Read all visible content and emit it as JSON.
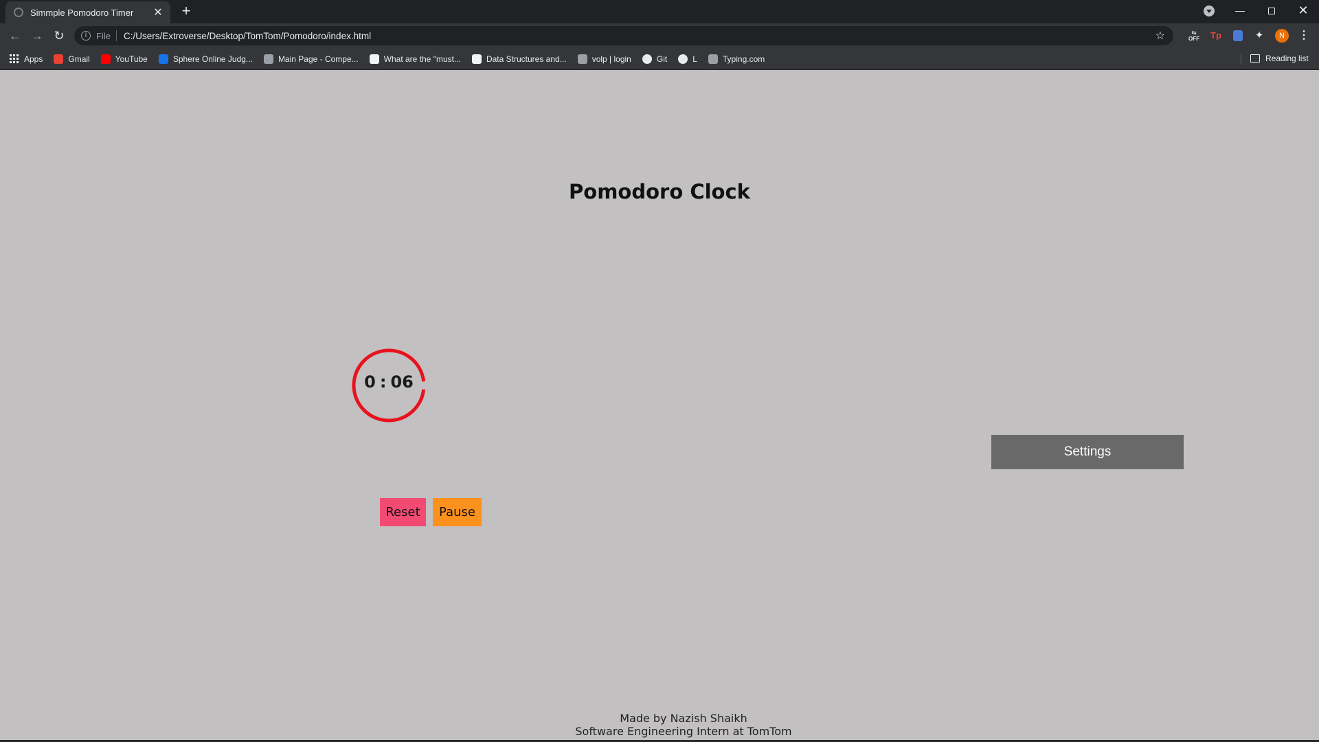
{
  "browser": {
    "tab_title": "Simmple Pomodoro Timer",
    "url_scheme": "File",
    "url": "C:/Users/Extroverse/Desktop/TomTom/Pomodoro/index.html",
    "extension_off_label": "OFF",
    "extension_tp_label": "Tp",
    "profile_initial": "N",
    "bookmarks": [
      {
        "label": "Apps",
        "icon": "apps-grid-icon",
        "color": "#e8eaed"
      },
      {
        "label": "Gmail",
        "icon": "gmail-icon",
        "color": "#ea4335"
      },
      {
        "label": "YouTube",
        "icon": "youtube-icon",
        "color": "#ff0000"
      },
      {
        "label": "Sphere Online Judg...",
        "icon": "spoj-icon",
        "color": "#1a73e8"
      },
      {
        "label": "Main Page - Compe...",
        "icon": "cp-wiki-icon",
        "color": "#9aa0a6"
      },
      {
        "label": "What are the \"must...",
        "icon": "quora-icon",
        "color": "#f1f3f4"
      },
      {
        "label": "Data Structures and...",
        "icon": "bulb-icon",
        "color": "#f1f3f4"
      },
      {
        "label": "volp | login",
        "icon": "volp-icon",
        "color": "#9aa0a6"
      },
      {
        "label": "Git",
        "icon": "github-icon",
        "color": "#e8eaed"
      },
      {
        "label": "L",
        "icon": "github-icon",
        "color": "#e8eaed"
      },
      {
        "label": "Typing.com",
        "icon": "typing-icon",
        "color": "#9aa0a6"
      }
    ],
    "reading_list": "Reading list"
  },
  "page": {
    "title": "Pomodoro Clock",
    "timer": {
      "minutes": "0",
      "separator": ":",
      "seconds": "06",
      "ring_color": "#e8121d"
    },
    "reset_label": "Reset",
    "pause_label": "Pause",
    "settings_label": "Settings",
    "footer_line1": "Made by Nazish Shaikh",
    "footer_line2": "Software Engineering Intern at TomTom"
  }
}
